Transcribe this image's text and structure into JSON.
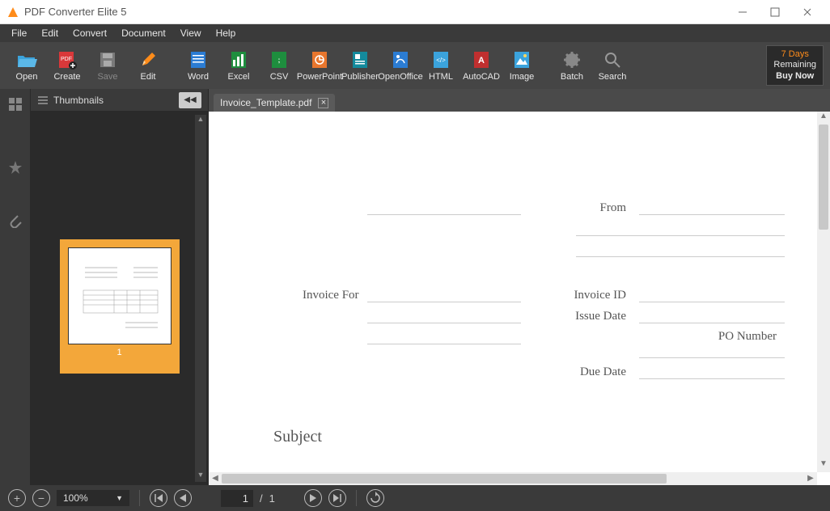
{
  "window": {
    "title": "PDF Converter Elite 5"
  },
  "menu": {
    "file": "File",
    "edit": "Edit",
    "convert": "Convert",
    "document": "Document",
    "view": "View",
    "help": "Help"
  },
  "toolbar": {
    "open": "Open",
    "create": "Create",
    "save": "Save",
    "edit": "Edit",
    "word": "Word",
    "excel": "Excel",
    "csv": "CSV",
    "powerpoint": "PowerPoint",
    "publisher": "Publisher",
    "openoffice": "OpenOffice",
    "html": "HTML",
    "autocad": "AutoCAD",
    "image": "Image",
    "batch": "Batch",
    "search": "Search"
  },
  "trial": {
    "line1": "7 Days",
    "line2": "Remaining",
    "line3": "Buy Now"
  },
  "thumbnails": {
    "header": "Thumbnails",
    "page1_num": "1"
  },
  "tab": {
    "name": "Invoice_Template.pdf"
  },
  "doc": {
    "from": "From",
    "invoice_for": "Invoice For",
    "invoice_id": "Invoice ID",
    "issue_date": "Issue Date",
    "po_number": "PO Number",
    "due_date": "Due Date",
    "subject": "Subject"
  },
  "status": {
    "zoom": "100%",
    "page_current": "1",
    "page_sep": "/",
    "page_total": "1"
  }
}
